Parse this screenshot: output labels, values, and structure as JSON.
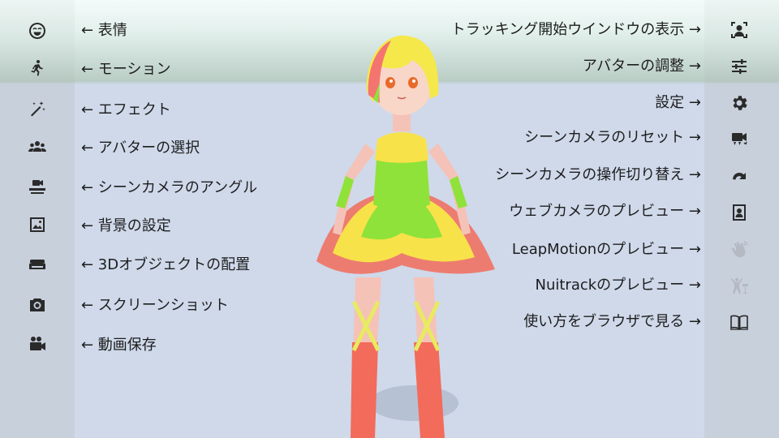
{
  "left_menu": [
    {
      "label": "← 表情",
      "icon": "face-icon"
    },
    {
      "label": "← モーション",
      "icon": "motion-icon"
    },
    {
      "label": "← エフェクト",
      "icon": "effect-wand-icon"
    },
    {
      "label": "← アバターの選択",
      "icon": "avatars-icon"
    },
    {
      "label": "← シーンカメラのアングル",
      "icon": "camera-angle-icon"
    },
    {
      "label": "← 背景の設定",
      "icon": "image-icon"
    },
    {
      "label": "← 3Dオブジェクトの配置",
      "icon": "sofa-icon"
    },
    {
      "label": "← スクリーンショット",
      "icon": "camera-icon"
    },
    {
      "label": "← 動画保存",
      "icon": "video-camera-icon"
    }
  ],
  "right_menu": [
    {
      "label": "トラッキング開始ウインドウの表示 →",
      "icon": "face-tracking-icon",
      "enabled": true
    },
    {
      "label": "アバターの調整 →",
      "icon": "sliders-icon",
      "enabled": true
    },
    {
      "label": "設定 →",
      "icon": "gear-icon",
      "enabled": true
    },
    {
      "label": "シーンカメラのリセット →",
      "icon": "camera-reset-icon",
      "enabled": true
    },
    {
      "label": "シーンカメラの操作切り替え →",
      "icon": "redo-arrow-icon",
      "enabled": true
    },
    {
      "label": "ウェブカメラのプレビュー →",
      "icon": "portrait-icon",
      "enabled": true
    },
    {
      "label": "LeapMotionのプレビュー →",
      "icon": "hand-wave-icon",
      "enabled": false
    },
    {
      "label": "Nuitrackのプレビュー →",
      "icon": "body-sensor-icon",
      "enabled": false
    },
    {
      "label": "使い方をブラウザで見る →",
      "icon": "book-icon",
      "enabled": true
    }
  ],
  "colors": {
    "icon": "#2a2a2a",
    "icon_disabled": "#b4b9c2",
    "hair_pink": "#f4756f",
    "hair_yellow": "#f5e84a",
    "dress_green": "#8fe23a",
    "dress_yellow": "#f8e24a",
    "dress_red": "#f26b5b"
  }
}
